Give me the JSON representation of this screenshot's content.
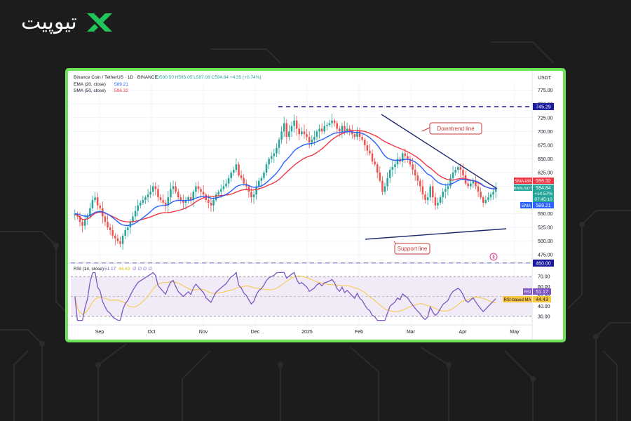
{
  "brand": {
    "name": "تیوپیت",
    "accent": "#21c45a"
  },
  "header": {
    "symbol": "Binance Coin / TetherUS · 1D · BINANCE",
    "ohlc": "O590.50 H595.05 L587.08 C594.84 +4.35 (+0.74%)",
    "ema_label": "EMA (20, close)",
    "ema_value": "589.21",
    "sma_label": "SMA (50, close)",
    "sma_value": "596.32"
  },
  "currency": "USDT",
  "rsi_header": {
    "label": "RSI (14, close)",
    "value": "51.17",
    "ma": "44.43",
    "extra": "∅ ∅ ∅ ∅"
  },
  "price_tags": {
    "level_high": "745.29",
    "level_low": "460.00",
    "sma_label": "SMA-MA",
    "sma": "596.32",
    "symbol": "BNBUSDT",
    "price": "594.84",
    "change": "+14.57%",
    "countdown": "07:45:10",
    "ema_label": "EMA",
    "ema": "589.21"
  },
  "rsi_tags": {
    "rsi_label": "RSI",
    "rsi": "51.17",
    "ma_label": "RSI-based MA",
    "ma": "44.43"
  },
  "annotations": {
    "downtrend": "Downtrend line",
    "support": "Support line"
  },
  "colors": {
    "up": "#26a69a",
    "down": "#ef5350",
    "ema": "#2962ff",
    "sma": "#f23645",
    "rsi": "#7e57c2",
    "rsi_ma": "#f7c744",
    "level": "#1a1a9c",
    "trend": "#1e2b6e"
  },
  "chart_data": [
    {
      "type": "candlestick",
      "title": "Binance Coin / TetherUS · 1D · BINANCE",
      "x_ticks": [
        "Sep",
        "Oct",
        "Nov",
        "Dec",
        "2025",
        "Feb",
        "Mar",
        "Apr",
        "May"
      ],
      "y_ticks": [
        475,
        500,
        525,
        550,
        575,
        600,
        625,
        650,
        675,
        700,
        725,
        750,
        775
      ],
      "ylim": [
        465,
        790
      ],
      "ylabel": "USDT",
      "horizontal_levels": [
        745.29,
        460.0
      ],
      "approx_closes": [
        550,
        545,
        535,
        528,
        540,
        545,
        560,
        575,
        580,
        565,
        560,
        545,
        535,
        525,
        520,
        510,
        505,
        500,
        495,
        510,
        520,
        525,
        535,
        545,
        555,
        565,
        570,
        575,
        580,
        585,
        590,
        600,
        595,
        580,
        575,
        570,
        565,
        580,
        595,
        600,
        590,
        580,
        575,
        570,
        575,
        580,
        575,
        590,
        600,
        595,
        590,
        585,
        575,
        570,
        565,
        575,
        585,
        590,
        595,
        600,
        605,
        615,
        625,
        630,
        640,
        620,
        615,
        605,
        600,
        590,
        580,
        585,
        600,
        610,
        615,
        625,
        640,
        650,
        655,
        660,
        670,
        685,
        700,
        715,
        690,
        700,
        710,
        720,
        705,
        695,
        700,
        695,
        690,
        680,
        685,
        690,
        700,
        705,
        700,
        710,
        712,
        715,
        720,
        715,
        705,
        700,
        710,
        700,
        705,
        700,
        695,
        690,
        700,
        690,
        685,
        675,
        665,
        660,
        645,
        640,
        625,
        610,
        590,
        600,
        615,
        630,
        635,
        640,
        650,
        645,
        660,
        655,
        650,
        640,
        630,
        620,
        610,
        600,
        585,
        575,
        580,
        600,
        580,
        565,
        570,
        580,
        590,
        595,
        600,
        615,
        625,
        630,
        635,
        630,
        620,
        605,
        600,
        605,
        610,
        600,
        590,
        580,
        570,
        575,
        580,
        585,
        590,
        595
      ],
      "ema": {
        "name": "EMA (20, close)",
        "last": 589.21
      },
      "sma": {
        "name": "SMA (50, close)",
        "last": 596.32
      },
      "last_close": 594.84
    },
    {
      "type": "line",
      "title": "RSI (14, close)",
      "y_ticks": [
        30,
        40,
        50,
        60,
        70
      ],
      "ylim": [
        25,
        75
      ],
      "bands": [
        30,
        50,
        70
      ],
      "series": [
        {
          "name": "RSI",
          "last": 51.17
        },
        {
          "name": "RSI-based MA",
          "last": 44.43
        }
      ]
    }
  ]
}
